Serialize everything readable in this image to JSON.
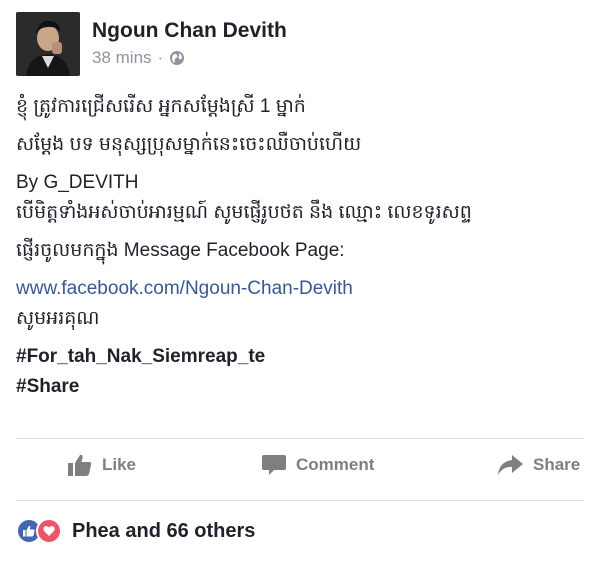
{
  "post": {
    "author": "Ngoun Chan Devith",
    "time": "38 mins",
    "separator": "·",
    "lines": [
      "ខ្ញុំ ត្រូវការជ្រើសរើស អ្នកសម្តែងស្រី 1 ម្នាក់",
      "សម្តែង បទ មនុស្សប្រុសម្នាក់នេះចេះឈឺចាប់ហើយ",
      "By G_DEVITH",
      "បើមិត្តទាំងអស់ចាប់អារម្មណ៍ សូមផ្ញើរូបថត នឹង ឈ្មោះ លេខទូរសព្ទ",
      "ផ្ញើរចូលមកក្នុង Message Facebook Page:",
      "www.facebook.com/Ngoun-Chan-Devith",
      "សូមអរគុណ",
      "#For_tah_Nak_Siemreap_te",
      "#Share"
    ]
  },
  "actions": {
    "like": "Like",
    "comment": "Comment",
    "share": "Share"
  },
  "reactions": {
    "text": "Phea and 66 others",
    "icons": [
      "like-icon",
      "love-icon"
    ]
  },
  "colors": {
    "link": "#365899",
    "action": "#7f7f7f",
    "like_badge": "#4267b2",
    "love_badge": "#f25268"
  }
}
